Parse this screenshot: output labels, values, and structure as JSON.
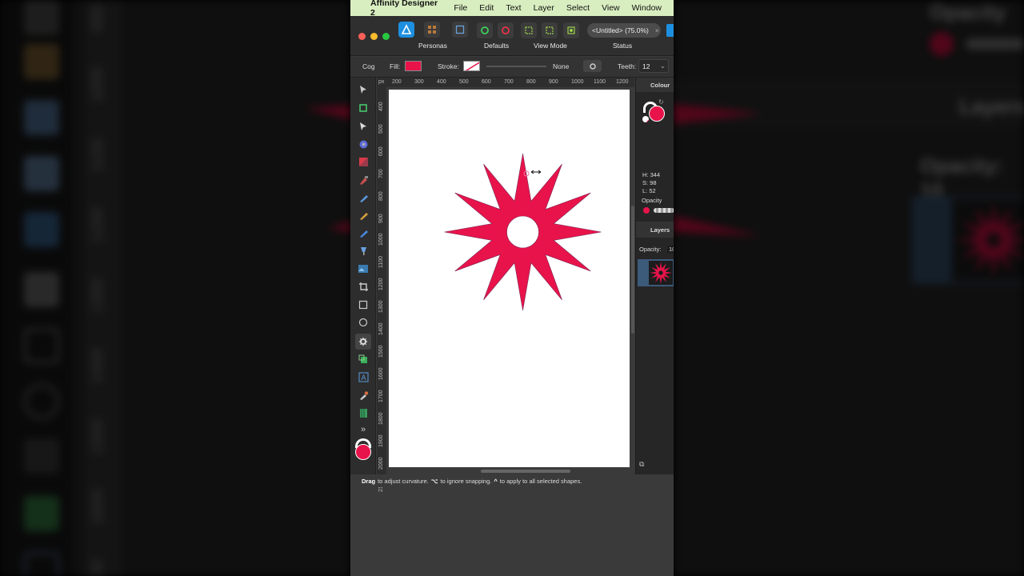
{
  "menubar": {
    "app_name": "Affinity Designer 2",
    "items": [
      "File",
      "Edit",
      "Text",
      "Layer",
      "Select",
      "View",
      "Window"
    ]
  },
  "toolbar": {
    "personas_label": "Personas",
    "defaults_label": "Defaults",
    "view_mode_label": "View Mode",
    "status_label": "Status",
    "document_tab": "<Untitled> (75.0%)"
  },
  "context_toolbar": {
    "tool_name": "Cog",
    "fill_label": "Fill:",
    "fill_color": "#e8134a",
    "stroke_label": "Stroke:",
    "stroke_value": "None",
    "teeth_label": "Teeth:",
    "teeth_value": "12"
  },
  "rulers": {
    "horizontal_ticks": [
      "px",
      "200",
      "300",
      "400",
      "500",
      "600",
      "700",
      "800",
      "900",
      "1000",
      "1100",
      "1200"
    ],
    "vertical_ticks": [
      "400",
      "500",
      "600",
      "700",
      "800",
      "900",
      "1000",
      "1100",
      "1200",
      "1300",
      "1400",
      "1500",
      "1600",
      "1700",
      "1800",
      "1900",
      "2000",
      "2100"
    ]
  },
  "colour_panel": {
    "title": "Colour",
    "h": "H: 344",
    "s": "S: 98",
    "l": "L: 52",
    "opacity_label": "Opacity"
  },
  "layers_panel": {
    "title": "Layers",
    "opacity_label": "Opacity:",
    "opacity_value": "10"
  },
  "status_hint": {
    "drag": "Drag",
    "part1": "to adjust curvature.",
    "key1": "⌥",
    "part2": "to ignore snapping.",
    "key2": "^",
    "part3": "to apply to all selected shapes."
  },
  "shape": {
    "type": "cog",
    "teeth": 12,
    "fill": "#e8134a"
  },
  "background": {
    "ruler_labels": [
      "900",
      "1000",
      "1100",
      "1200",
      "1300",
      "1400",
      "1500",
      "1600",
      "1700"
    ],
    "opacity_label": "Opacity",
    "layers_label": "Layers",
    "opacity_value_label": "Opacity: 10"
  }
}
